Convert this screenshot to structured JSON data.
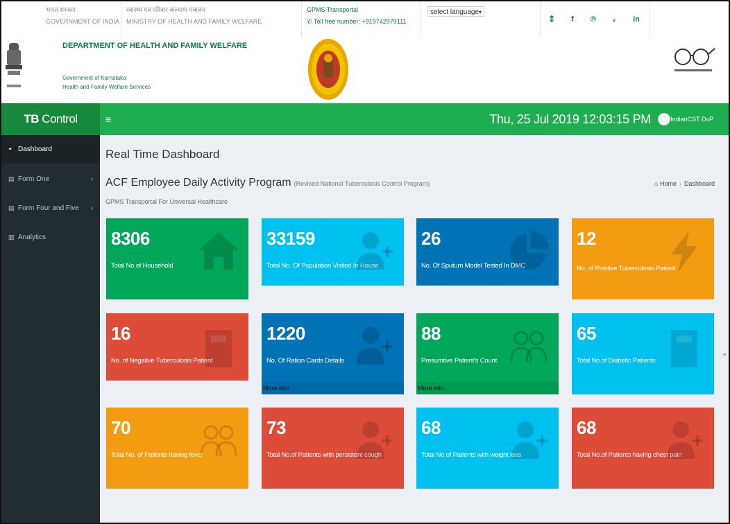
{
  "topbar": {
    "india_hindi": "भारत सरकार",
    "india": "GOVERNMENT OF INDIA",
    "ministry_hindi": "स्वास्थ्य एवं परिवार कल्याण मंत्रालय",
    "ministry": "MINISTRY OF HEALTH AND FAMILY WELFARE",
    "transport": "GPMS Transportal",
    "tollfree": "Toll free number: +919742979111",
    "language_select": "select language",
    "social_icons": [
      "sitemap-icon",
      "facebook-icon",
      "pinterest-icon",
      "twitter-icon",
      "linkedin-icon"
    ]
  },
  "header": {
    "department": "DEPARTMENT OF HEALTH AND FAMILY WELFARE",
    "gov_line1": "Government of Karnataka",
    "gov_line2": "Health and Family Welfare Services"
  },
  "navbar": {
    "brand_bold": "TB",
    "brand_rest": " Control Program",
    "menu_icon": "≡",
    "datetime": "Thu, 25 Jul 2019  12:03:15 PM",
    "user": "IndianCST DvP"
  },
  "sidebar": {
    "items": [
      {
        "label": "Dashboard",
        "icon": "dashboard-icon"
      },
      {
        "label": "Form One",
        "icon": "file-icon"
      },
      {
        "label": "Form Four and Five",
        "icon": "file-icon"
      },
      {
        "label": "Analytics",
        "icon": "chart-icon"
      }
    ]
  },
  "content": {
    "page_title": "Real Time Dashboard",
    "section_title": "ACF Employee Daily Activity Program",
    "section_small": "(Revised National Tuberculosis Control Program)",
    "section_sub": "GPMS Transportal For Universal Healthcare",
    "crumb_home": "Home",
    "crumb_current": "Dashboard"
  },
  "boxes": [
    {
      "value": "8306",
      "label": "Total No.of Household",
      "color": "#00a65a",
      "icon": "home-icon"
    },
    {
      "value": "33159",
      "label": "Total No. Of Population Visited In House",
      "color": "#00c0ef",
      "icon": "user-plus-icon"
    },
    {
      "value": "26",
      "label": "No. Of Sputum Model Tested In DMC",
      "color": "#0073b7",
      "icon": "pie-chart-icon"
    },
    {
      "value": "12",
      "label": "No. of Positive Tuberculosis Patient",
      "color": "#f39c12",
      "icon": "bolt-icon"
    },
    {
      "value": "16",
      "label": "No. of Negative Tuberculosis Patient",
      "color": "#dd4b39",
      "icon": "hospital-icon"
    },
    {
      "value": "1220",
      "label": "No. Of Ration Cards Details",
      "color": "#0073b7",
      "icon": "user-plus-icon",
      "more": "More info"
    },
    {
      "value": "88",
      "label": "Presumtive Patient's Count",
      "color": "#00a65a",
      "icon": "users-icon",
      "more": "More info"
    },
    {
      "value": "65",
      "label": "Total No.of Diabetic Patients",
      "color": "#00c0ef",
      "icon": "hospital-icon"
    },
    {
      "value": "70",
      "label": "Total No. of Patients having fever",
      "color": "#f39c12",
      "icon": "users-icon"
    },
    {
      "value": "73",
      "label": "Total No.of Patients with persistent cough",
      "color": "#dd4b39",
      "icon": "user-plus-icon"
    },
    {
      "value": "68",
      "label": "Total No.of Patients with weight loss",
      "color": "#00c0ef",
      "icon": "user-plus-icon"
    },
    {
      "value": "68",
      "label": "Total No.of Patients having chest pain",
      "color": "#dd4b39",
      "icon": "user-plus-icon"
    }
  ]
}
